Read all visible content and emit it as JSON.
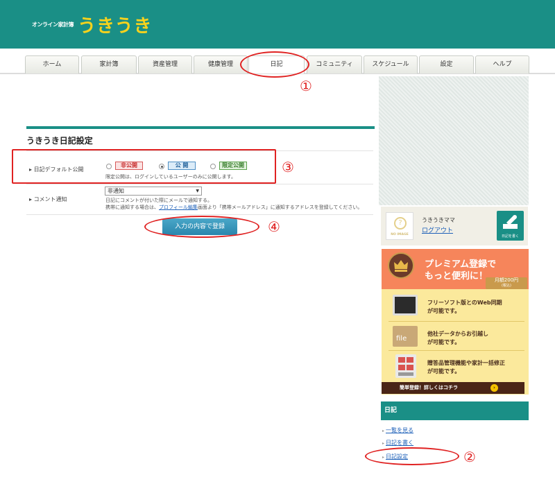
{
  "header": {
    "logo_small": "オンライン家計簿",
    "logo_big": "うきうき"
  },
  "nav": {
    "tabs": [
      "ホーム",
      "家計簿",
      "資産管理",
      "健康管理",
      "日記",
      "コミュニティ",
      "スケジュール",
      "設定",
      "ヘルプ"
    ],
    "active": "日記"
  },
  "annotations": [
    "①",
    "②",
    "③",
    "④"
  ],
  "settings": {
    "title": "うきうき日記設定",
    "default_public": {
      "label": "日記デフォルト公開",
      "options": [
        "非公開",
        "公 開",
        "限定公開"
      ],
      "selected": "公 開",
      "note": "限定公開は、ログインしているユーザーのみに公開します。"
    },
    "comment_notify": {
      "label": "コメント通知",
      "value": "非通知",
      "note1": "日記にコメントが付いた際にメールで通知する。",
      "note2_pre": "携帯に通知する場合は、",
      "note2_link": "プロフィール編集",
      "note2_post": "画面より「携帯メールアドレス」に通知するアドレスを登録してください。"
    },
    "submit_label": "入力の内容で登録"
  },
  "sidebar": {
    "avatar_text": "NO IMAGE",
    "avatar_glyph": "?",
    "username": "うきうきママ",
    "logout": "ログアウト",
    "write_label": "日記を書く",
    "premium": {
      "title": "プレミアム登録で",
      "subtitle": "もっと便利に！",
      "price": "月額200円",
      "price_note": "(税込)",
      "features": [
        {
          "line1": "フリーソフト版とのWeb同期",
          "line2": "が可能です。"
        },
        {
          "line1": "他社データからお引越し",
          "line2": "が可能です。"
        },
        {
          "line1": "贈答品管理機能や家計一括修正",
          "line2": "が可能です。"
        }
      ],
      "file_label": "file",
      "cta": "簡単登録！詳しくはコチラ",
      "cta_arrow": "›"
    },
    "diary": {
      "title": "日記",
      "links": [
        "一覧を見る",
        "日記を書く",
        "日記設定"
      ]
    }
  }
}
